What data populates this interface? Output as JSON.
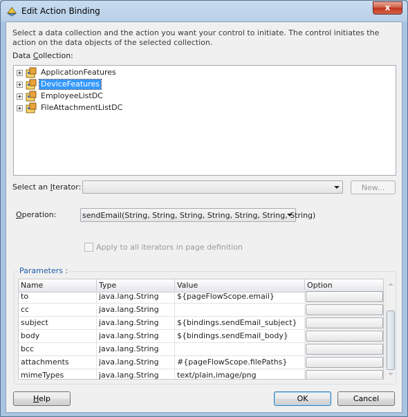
{
  "window": {
    "title": "Edit Action Binding",
    "close_glyph": "x"
  },
  "description": "Select a data collection and the action you want your control to initiate. The control initiates the action on the data objects of the selected collection.",
  "data_collection": {
    "label_pre": "Data ",
    "label_mnemonic": "C",
    "label_post": "ollection:",
    "items": [
      {
        "label": "ApplicationFeatures",
        "selected": false
      },
      {
        "label": "DeviceFeatures",
        "selected": true
      },
      {
        "label": "EmployeeListDC",
        "selected": false
      },
      {
        "label": "FileAttachmentListDC",
        "selected": false
      }
    ]
  },
  "iterator": {
    "label_pre": "Select an ",
    "label_mnemonic": "I",
    "label_post": "terator:",
    "value": "",
    "new_button": "New..."
  },
  "operation": {
    "label_pre": "",
    "label_mnemonic": "O",
    "label_post": "peration:",
    "value": "sendEmail(String, String, String, String, String, String, String)"
  },
  "apply_all": {
    "label": "Apply to all iterators in page definition",
    "checked": false
  },
  "parameters": {
    "title": "Parameters :",
    "columns": [
      "Name",
      "Type",
      "Value",
      "Option"
    ],
    "rows": [
      {
        "name": "to",
        "type": "java.lang.String",
        "value": "${pageFlowScope.email}"
      },
      {
        "name": "cc",
        "type": "java.lang.String",
        "value": ""
      },
      {
        "name": "subject",
        "type": "java.lang.String",
        "value": "${bindings.sendEmail_subject}"
      },
      {
        "name": "body",
        "type": "java.lang.String",
        "value": "${bindings.sendEmail_body}"
      },
      {
        "name": "bcc",
        "type": "java.lang.String",
        "value": ""
      },
      {
        "name": "attachments",
        "type": "java.lang.String",
        "value": "#{pageFlowScope.filePaths}"
      },
      {
        "name": "mimeTypes",
        "type": "java.lang.String",
        "value": "text/plain,image/png"
      }
    ]
  },
  "buttons": {
    "help": "Help",
    "help_mnemonic": "H",
    "ok": "OK",
    "cancel": "Cancel"
  }
}
